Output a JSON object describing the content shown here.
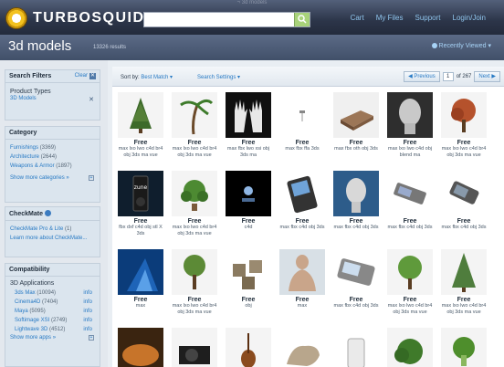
{
  "topbar": {
    "page_caption": "¬ 3d models",
    "logo_text": "TURBOSQUID",
    "search_value": "",
    "nav": [
      "Cart",
      "My Files",
      "Support",
      "Login/Join"
    ]
  },
  "header": {
    "title": "3d models",
    "count": "13326 results",
    "sort_recent": "Recently Viewed"
  },
  "filters": {
    "heading": "Search Filters",
    "clear": "Clear",
    "product_types_label": "Product Types",
    "product_type_value": "3D Models"
  },
  "category": {
    "heading": "Category",
    "items": [
      {
        "name": "Furnishings",
        "count": "(3369)"
      },
      {
        "name": "Architecture",
        "count": "(2644)"
      },
      {
        "name": "Weapons & Armor",
        "count": "(1897)"
      }
    ],
    "more": "Show more categories »"
  },
  "checkmate": {
    "heading": "CheckMate",
    "items": [
      {
        "name": "CheckMate Pro & Lite",
        "count": "(1)"
      }
    ],
    "learn": "Learn more about CheckMate..."
  },
  "compat": {
    "heading": "Compatibility",
    "sub": "3D Applications",
    "items": [
      {
        "name": "3ds Max",
        "count": "(10094)"
      },
      {
        "name": "Cinema4D",
        "count": "(7404)"
      },
      {
        "name": "Maya",
        "count": "(5095)"
      },
      {
        "name": "Softimage XSI",
        "count": "(2749)"
      },
      {
        "name": "Lightwave 3D",
        "count": "(4512)"
      }
    ],
    "info_label": "info",
    "more": "Show more apps »"
  },
  "toolbar": {
    "sort_label": "Sort by:",
    "sort_value": "Best Match",
    "search_settings": "Search Settings",
    "previous": "◀ Previous",
    "page": "1",
    "of_total": "of 267",
    "next": "Next ▶"
  },
  "products": [
    {
      "price": "Free",
      "formats": "max lxo lwo c4d br4 obj 3ds ma vue",
      "icon": "pine-tree"
    },
    {
      "price": "Free",
      "formats": "max lxo lwo c4d br4 obj 3ds ma vue",
      "icon": "palm-tree"
    },
    {
      "price": "Free",
      "formats": "max fbx lwo xsi obj 3ds ma",
      "icon": "hands"
    },
    {
      "price": "Free",
      "formats": "max fbx ffa 3ds",
      "icon": "stool"
    },
    {
      "price": "Free",
      "formats": "max fbx oth obj 3ds",
      "icon": "bed"
    },
    {
      "price": "Free",
      "formats": "max lxo lwo c4d obj blend ma",
      "icon": "head"
    },
    {
      "price": "Free",
      "formats": "max lxo lwo c4d br4 obj 3ds ma vue",
      "icon": "autumn-tree"
    },
    {
      "price": "Free",
      "formats": "fbx dxf c4d obj stl X 3ds",
      "icon": "zune"
    },
    {
      "price": "Free",
      "formats": "max lxo lwo c4d br4 obj 3ds ma vue",
      "icon": "plant"
    },
    {
      "price": "Free",
      "formats": "c4d",
      "icon": "dark-scene"
    },
    {
      "price": "Free",
      "formats": "max fbx c4d obj 3ds",
      "icon": "phone"
    },
    {
      "price": "Free",
      "formats": "max fbx c4d obj 3ds",
      "icon": "head-blue"
    },
    {
      "price": "Free",
      "formats": "max fbx c4d obj 3ds",
      "icon": "slider-phone"
    },
    {
      "price": "Free",
      "formats": "max fbx c4d obj 3ds",
      "icon": "flip-phone"
    },
    {
      "price": "Free",
      "formats": "max",
      "icon": "blue-scene"
    },
    {
      "price": "Free",
      "formats": "max lxo lwo c4d br4 obj 3ds ma vue",
      "icon": "oak-tree"
    },
    {
      "price": "Free",
      "formats": "obj",
      "icon": "dice"
    },
    {
      "price": "Free",
      "formats": "max",
      "icon": "torso"
    },
    {
      "price": "Free",
      "formats": "max fbx c4d obj 3ds",
      "icon": "phone-slide"
    },
    {
      "price": "Free",
      "formats": "max lxo lwo c4d br4 obj 3ds ma vue",
      "icon": "leafy-tree"
    },
    {
      "price": "Free",
      "formats": "max lxo lwo c4d br4 obj 3ds ma vue",
      "icon": "conifer"
    },
    {
      "price": "",
      "formats": "",
      "icon": "orange-scene"
    },
    {
      "price": "",
      "formats": "",
      "icon": "turntable"
    },
    {
      "price": "",
      "formats": "",
      "icon": "violin"
    },
    {
      "price": "",
      "formats": "",
      "icon": "creature"
    },
    {
      "price": "",
      "formats": "",
      "icon": "white-phone"
    },
    {
      "price": "",
      "formats": "",
      "icon": "bush"
    },
    {
      "price": "",
      "formats": "",
      "icon": "broccoli"
    }
  ]
}
